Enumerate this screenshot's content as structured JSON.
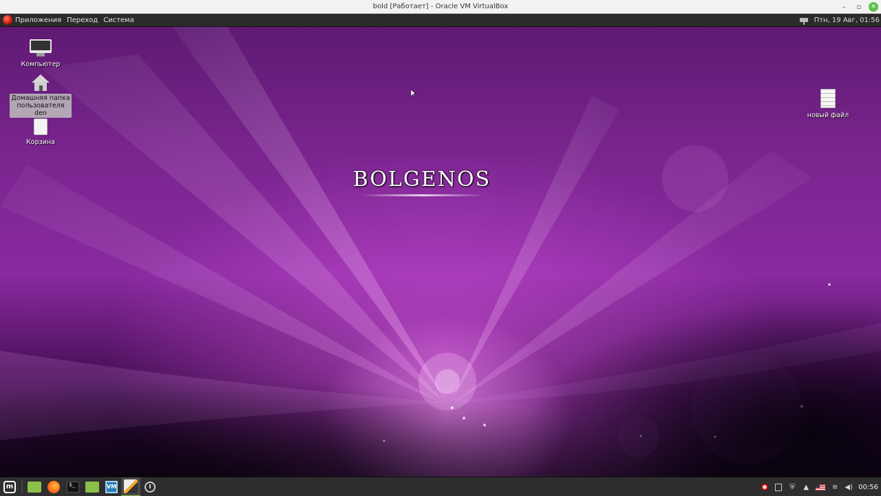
{
  "host_window": {
    "title": "bold [Работает] - Oracle VM VirtualBox",
    "minimize": "–",
    "maximize": "▫",
    "close": "✕"
  },
  "top_panel": {
    "menu": [
      "Приложения",
      "Переход",
      "Система"
    ],
    "datetime": "Птн, 19 Авг, 01:56"
  },
  "desktop": {
    "brand": "BOLGENOS",
    "icons": [
      {
        "label": "Компьютер",
        "icon": "computer-icon"
      },
      {
        "label": "Домашняя папка пользователя den",
        "icon": "home-folder-icon",
        "selected": true
      },
      {
        "label": "Корзина",
        "icon": "trash-icon"
      },
      {
        "label": "новый файл",
        "icon": "text-file-icon"
      }
    ]
  },
  "taskbar": {
    "launchers": [
      "mint-menu-icon",
      "files-icon",
      "firefox-icon",
      "terminal-icon",
      "folder-icon",
      "virtualbox-icon",
      "text-editor-icon",
      "clock-app-icon"
    ],
    "terminal_glyph": "$_",
    "menu_glyph": "m",
    "vbox_glyph": "VM",
    "tray_glyphs": {
      "shield": "⛨",
      "update": "▲",
      "wifi": "≋",
      "volume": "◀)"
    },
    "clock": "00:56"
  },
  "colors": {
    "wallpaper_accent": "#8a2aa0",
    "panel": "#2b2b2b",
    "taskbar": "#2e2e2e",
    "active_indicator": "#8fbf4c"
  }
}
